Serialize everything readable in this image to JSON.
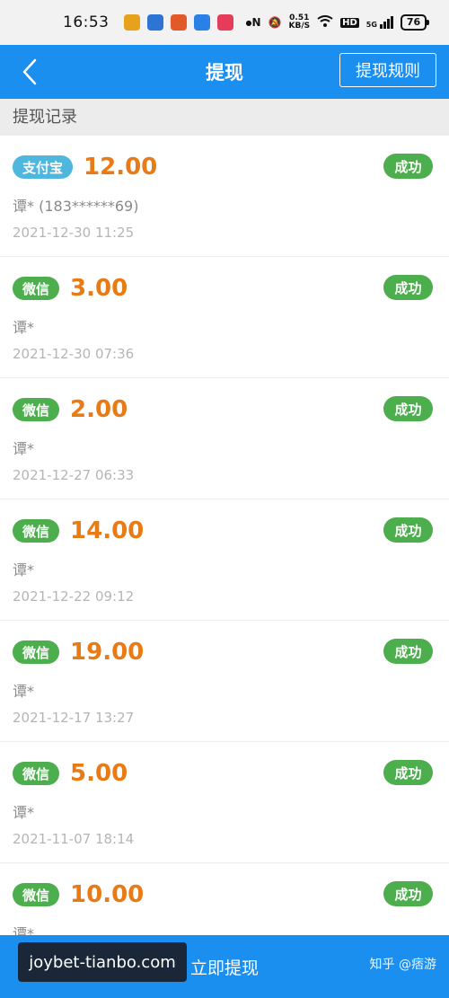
{
  "status_bar": {
    "time": "16:53",
    "network_speed_value": "0.51",
    "network_speed_unit": "KB/S",
    "hd": "HD",
    "signal": "5G",
    "battery": "76",
    "app_dot_colors": [
      "#e6a21a",
      "#2e74d4",
      "#e35a2a",
      "#2b80e8",
      "#e63b5a"
    ]
  },
  "header": {
    "title": "提现",
    "rules_label": "提现规则"
  },
  "section": {
    "title": "提现记录"
  },
  "records": [
    {
      "channel": "支付宝",
      "channel_type": "alipay",
      "amount": "12.00",
      "status": "成功",
      "name": "谭* (183******69)",
      "date": "2021-12-30 11:25"
    },
    {
      "channel": "微信",
      "channel_type": "wechat",
      "amount": "3.00",
      "status": "成功",
      "name": "谭*",
      "date": "2021-12-30 07:36"
    },
    {
      "channel": "微信",
      "channel_type": "wechat",
      "amount": "2.00",
      "status": "成功",
      "name": "谭*",
      "date": "2021-12-27 06:33"
    },
    {
      "channel": "微信",
      "channel_type": "wechat",
      "amount": "14.00",
      "status": "成功",
      "name": "谭*",
      "date": "2021-12-22 09:12"
    },
    {
      "channel": "微信",
      "channel_type": "wechat",
      "amount": "19.00",
      "status": "成功",
      "name": "谭*",
      "date": "2021-12-17 13:27"
    },
    {
      "channel": "微信",
      "channel_type": "wechat",
      "amount": "5.00",
      "status": "成功",
      "name": "谭*",
      "date": "2021-11-07 18:14"
    },
    {
      "channel": "微信",
      "channel_type": "wechat",
      "amount": "10.00",
      "status": "成功",
      "name": "谭*",
      "date": ""
    }
  ],
  "bottom_bar": {
    "action_label": "立即提现",
    "watermark_left": "joybet-tianbo.com",
    "watermark_right": "知乎 @痞游"
  },
  "colors": {
    "primary": "#1a8ff0",
    "amount": "#e87b16",
    "success": "#4cae4c",
    "alipay": "#4fb6de"
  }
}
